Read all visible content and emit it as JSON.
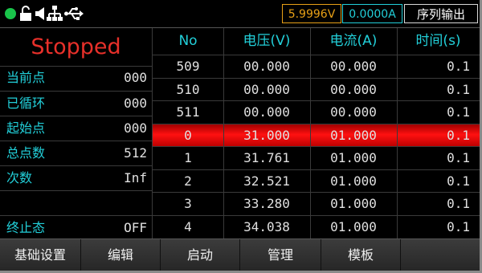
{
  "status_bar": {
    "voltage": "5.9996V",
    "current": "0.0000A",
    "mode": "序列输出",
    "colors": {
      "running_dot": "#19c44a",
      "voltage": "#e8a016",
      "current": "#22cfd9"
    },
    "icons": [
      "status-dot-icon",
      "lock-icon",
      "speaker-icon",
      "network-icon",
      "usb-icon"
    ]
  },
  "left_panel": {
    "state": "Stopped",
    "rows": [
      {
        "label": "当前点",
        "value": "000"
      },
      {
        "label": "已循环",
        "value": "000"
      },
      {
        "label": "起始点",
        "value": "000"
      },
      {
        "label": "总点数",
        "value": "512"
      },
      {
        "label": "次数",
        "value": "Inf"
      },
      {
        "label": "",
        "value": ""
      },
      {
        "label": "终止态",
        "value": "OFF"
      }
    ]
  },
  "table": {
    "headers": [
      "No",
      "电压(V)",
      "电流(A)",
      "时间(s)"
    ],
    "selected_index": 3,
    "rows": [
      {
        "no": "509",
        "voltage": "00.000",
        "current": "00.000",
        "time": "0.1"
      },
      {
        "no": "510",
        "voltage": "00.000",
        "current": "00.000",
        "time": "0.1"
      },
      {
        "no": "511",
        "voltage": "00.000",
        "current": "00.000",
        "time": "0.1"
      },
      {
        "no": "0",
        "voltage": "31.000",
        "current": "01.000",
        "time": "0.1"
      },
      {
        "no": "1",
        "voltage": "31.761",
        "current": "01.000",
        "time": "0.1"
      },
      {
        "no": "2",
        "voltage": "32.521",
        "current": "01.000",
        "time": "0.1"
      },
      {
        "no": "3",
        "voltage": "33.280",
        "current": "01.000",
        "time": "0.1"
      },
      {
        "no": "4",
        "voltage": "34.038",
        "current": "01.000",
        "time": "0.1"
      }
    ]
  },
  "softkeys": [
    "基础设置",
    "编辑",
    "启动",
    "管理",
    "模板",
    ""
  ]
}
